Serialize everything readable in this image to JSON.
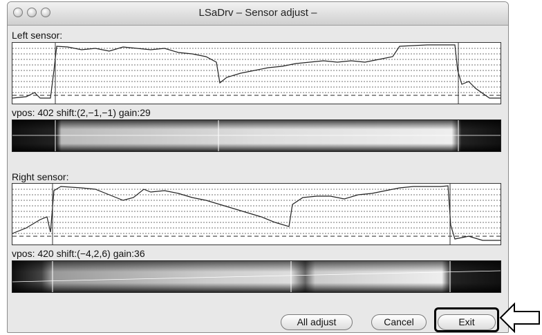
{
  "window": {
    "title": "LSaDrv – Sensor adjust –"
  },
  "left_sensor": {
    "label": "Left sensor:",
    "status": "vpos:  402 shift:(2,−1,−1) gain:29"
  },
  "right_sensor": {
    "label": "Right sensor:",
    "status": "vpos:  420 shift:(−4,2,6) gain:36"
  },
  "buttons": {
    "all_adjust": "All adjust",
    "cancel": "Cancel",
    "exit": "Exit"
  },
  "icons": {
    "window_controls": [
      "close-icon",
      "minimize-icon",
      "zoom-icon"
    ],
    "pointer": "arrow-left-icon"
  }
}
